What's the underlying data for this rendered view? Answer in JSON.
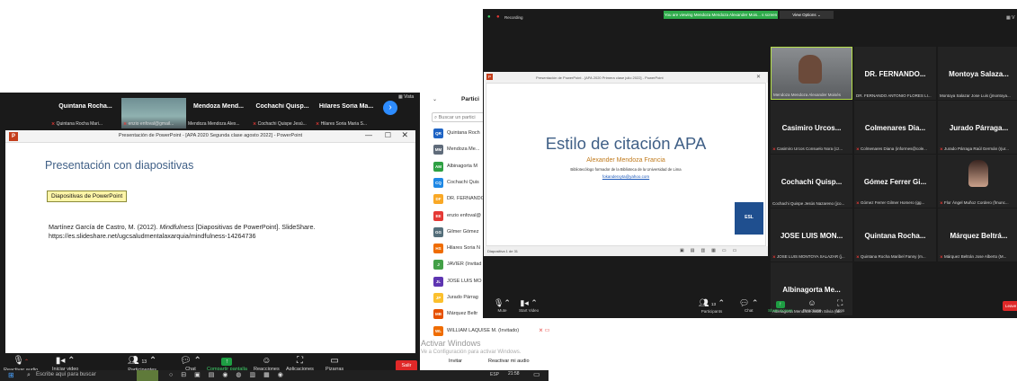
{
  "left_window": {
    "view_label": "Vista",
    "thumbnails": [
      {
        "name": "Quintana Rocha...",
        "sub": "Quintana Rocha Mari..."
      },
      {
        "name": "",
        "sub": "enzio enfoval@gmail..."
      },
      {
        "name": "Mendoza Mend...",
        "sub": "Mendoza Mendoza Alex..."
      },
      {
        "name": "Cochachi Quisp...",
        "sub": "Cochachi Quispe Jesú..."
      },
      {
        "name": "Hilares Soria Ma...",
        "sub": "Hilares Soria Maria S..."
      }
    ],
    "ppt_title": "Presentación de PowerPoint - [APA 2020 Segunda clase agosto 2022] - PowerPoint",
    "slide": {
      "heading": "Presentación con diapositivas",
      "box_label": "Diapositivas de PowerPoint",
      "citation_prefix": "Martínez García de Castro, M. (2012). ",
      "citation_italic": "Mindfulness",
      "citation_suffix": " [Diapositivas de PowerPoint]. SlideShare.",
      "citation_url": "https://es.slideshare.net/ugcsaludmentalaxarquia/mindfulness-14264736"
    },
    "toolbar": {
      "audio": "Reactivar audio",
      "video": "Iniciar video",
      "participants": "Participantes",
      "participants_count": "13",
      "chat": "Chat",
      "share": "Compartir pantalla",
      "reactions": "Reacciones",
      "apps": "Aplicaciones",
      "whiteboards": "Pizarras",
      "leave": "Salir"
    },
    "taskbar": {
      "search_placeholder": "Escribe aquí para buscar",
      "lang": "ESP",
      "time": "21:58"
    }
  },
  "participants_panel": {
    "title": "Partici",
    "search_placeholder": "Buscar un partici",
    "items": [
      {
        "initials": "QR",
        "name": "Quintana Roch",
        "color": "#1e63c4"
      },
      {
        "initials": "MM",
        "name": "Mendoza Me...",
        "color": "#5f6b7a"
      },
      {
        "initials": "AM",
        "name": "Albinagorta M",
        "color": "#2ea043"
      },
      {
        "initials": "CQ",
        "name": "Cochachi Quis",
        "color": "#1e88e5"
      },
      {
        "initials": "DF",
        "name": "DR. FERNANDO",
        "color": "#f9a825"
      },
      {
        "initials": "EE",
        "name": "enzio enfoval@",
        "color": "#e53935"
      },
      {
        "initials": "GG",
        "name": "Gilmer Gómez",
        "color": "#546e7a"
      },
      {
        "initials": "HS",
        "name": "Hilares Soria N",
        "color": "#ef6c00"
      },
      {
        "initials": "J",
        "name": "JAVIER (Invitad",
        "color": "#43a047"
      },
      {
        "initials": "JL",
        "name": "JOSE LUIS MO",
        "color": "#5e35b1"
      },
      {
        "initials": "JP",
        "name": "Jurado Párrag",
        "color": "#fbc02d"
      },
      {
        "initials": "MB",
        "name": "Márquez Beltr",
        "color": "#e65100"
      },
      {
        "initials": "WL",
        "name": "WILLIAM LAQUISE M. (Invitado)",
        "color": "#ef6c00"
      }
    ],
    "invite": "Invitar",
    "unmute": "Reactivar mi audio",
    "activate_windows": "Activar Windows",
    "activate_windows_sub": "Ve a Configuración para activar Windows."
  },
  "right_window": {
    "recording": "Recording",
    "viewing_banner": "You are viewing Mendoza Mendoza Alexander Mois... s screen",
    "view_options": "View Options",
    "ppt_title": "Presentación de PowerPoint - [APA 2020 Primera clase julio 2022] - PowerPoint",
    "slide": {
      "title": "Estilo de citación APA",
      "author": "Alexander Mendoza Francia",
      "role": "Bibliotecólogo formador de la Biblioteca de la Universidad de Lima",
      "email": "fokanderxyta@yahoo.com",
      "logo_text": "ESL"
    },
    "slide_counter": "Diapositiva 1 de 31",
    "tiles": [
      {
        "name": "",
        "sub": "Mendoza Mendoza Alexander Moisés"
      },
      {
        "name": "DR. FERNANDO...",
        "sub": "DR. FERNANDO ANTONIO FLORES LI..."
      },
      {
        "name": "Montoya Salaza...",
        "sub": "Montoya Salazar Jose Luis (jmontoya..."
      },
      {
        "name": "Casimiro Urcos...",
        "sub": "Casimiro Urcos Consuelo Nora (cz..."
      },
      {
        "name": "Colmenares Dia...",
        "sub": "Colmenares Diana (informes@cole..."
      },
      {
        "name": "Jurado Párraga...",
        "sub": "Jurado Párraga Raúl Germán (rjur..."
      },
      {
        "name": "Cochachi Quisp...",
        "sub": "Cochachi Quispe Jesús Nazareno (jco..."
      },
      {
        "name": "Gómez Ferrer Gi...",
        "sub": "Gómez Ferrer Gilmer Homero (gg..."
      },
      {
        "name": "",
        "sub": "Flor Ángel Muñoz Cordero (fmunc..."
      },
      {
        "name": "JOSE LUIS MON...",
        "sub": "JOSE LUIS MONTOYA SALAZAR (j..."
      },
      {
        "name": "Quintana Rocha...",
        "sub": "Quintana Rocha Maribel Fanny (m..."
      },
      {
        "name": "Márquez Beltrá...",
        "sub": "Márquez Beltrán Jose Alberto (M..."
      },
      {
        "name": "Albinagorta Me...",
        "sub": "Albinagorta Mendoza Judith Silvia (ali..."
      }
    ],
    "toolbar": {
      "mute": "Mute",
      "video": "Start Video",
      "participants": "Participants",
      "participants_count": "13",
      "chat": "Chat",
      "share": "Share Screen",
      "reactions": "Reactions",
      "apps": "Apps",
      "leave": "Leave"
    }
  }
}
